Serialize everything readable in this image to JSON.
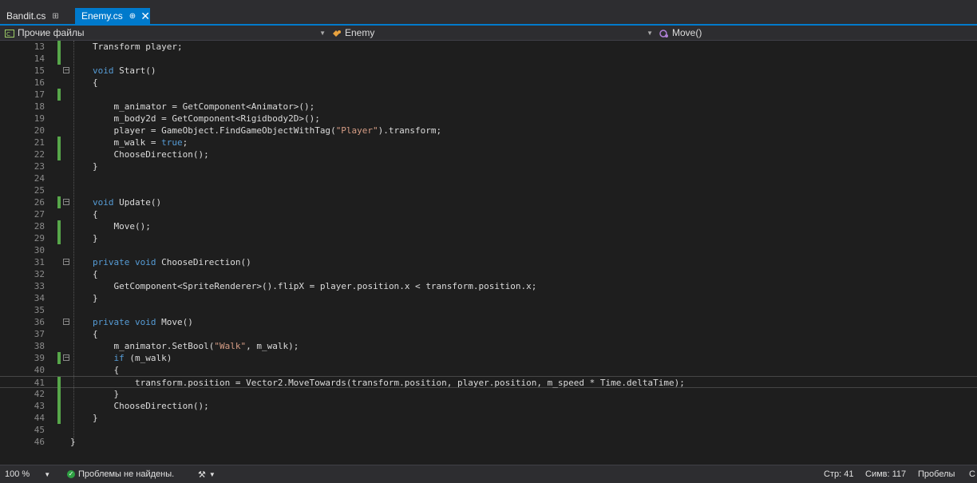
{
  "tabs": [
    {
      "label": "Bandit.cs",
      "pin": "⊞"
    },
    {
      "label": "Enemy.cs",
      "pin": "⊕",
      "close": "✕",
      "active": true
    }
  ],
  "nav": {
    "project": "Прочие файлы",
    "class": "Enemy",
    "member": "Move()"
  },
  "editor": {
    "lines": [
      {
        "n": "13",
        "code": "Transform player;"
      },
      {
        "n": "14",
        "code": ""
      },
      {
        "n": "15",
        "code": "void Start()"
      },
      {
        "n": "16",
        "code": "{"
      },
      {
        "n": "17",
        "code": ""
      },
      {
        "n": "18",
        "code": "    m_animator = GetComponent<Animator>();"
      },
      {
        "n": "19",
        "code": "    m_body2d = GetComponent<Rigidbody2D>();"
      },
      {
        "n": "20",
        "code": "    player = GameObject.FindGameObjectWithTag(\"Player\").transform;"
      },
      {
        "n": "21",
        "code": "    m_walk = true;"
      },
      {
        "n": "22",
        "code": "    ChooseDirection();"
      },
      {
        "n": "23",
        "code": "}"
      },
      {
        "n": "24",
        "code": ""
      },
      {
        "n": "25",
        "code": ""
      },
      {
        "n": "26",
        "code": "void Update()"
      },
      {
        "n": "27",
        "code": "{"
      },
      {
        "n": "28",
        "code": "    Move();"
      },
      {
        "n": "29",
        "code": "}"
      },
      {
        "n": "30",
        "code": ""
      },
      {
        "n": "31",
        "code": "private void ChooseDirection()"
      },
      {
        "n": "32",
        "code": "{"
      },
      {
        "n": "33",
        "code": "    GetComponent<SpriteRenderer>().flipX = player.position.x < transform.position.x;"
      },
      {
        "n": "34",
        "code": "}"
      },
      {
        "n": "35",
        "code": ""
      },
      {
        "n": "36",
        "code": "private void Move()"
      },
      {
        "n": "37",
        "code": "{"
      },
      {
        "n": "38",
        "code": "    m_animator.SetBool(\"Walk\", m_walk);"
      },
      {
        "n": "39",
        "code": "    if (m_walk)"
      },
      {
        "n": "40",
        "code": "    {"
      },
      {
        "n": "41",
        "code": "        transform.position = Vector2.MoveTowards(transform.position, player.position, m_speed * Time.deltaTime);"
      },
      {
        "n": "42",
        "code": "    }"
      },
      {
        "n": "43",
        "code": "    ChooseDirection();"
      },
      {
        "n": "44",
        "code": "}"
      },
      {
        "n": "45",
        "code": ""
      },
      {
        "n": "46",
        "code": "}"
      }
    ]
  },
  "status": {
    "zoom": "100 %",
    "issues": "Проблемы не найдены.",
    "line": "Стр: 41",
    "col": "Симв: 117",
    "spaces": "Пробелы",
    "overflow": "С"
  },
  "colors": {
    "accent": "#007acc",
    "keyword": "#569cd6",
    "string": "#d69d85",
    "change": "#57a64a"
  }
}
